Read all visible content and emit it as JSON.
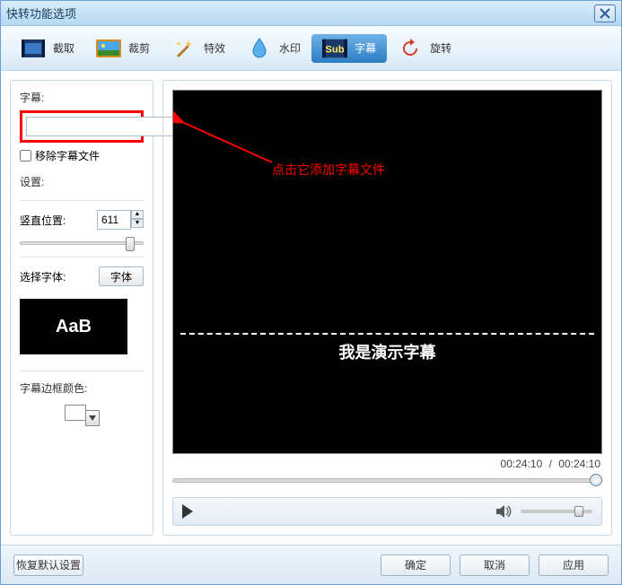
{
  "window": {
    "title": "快转功能选项"
  },
  "toolbar": {
    "items": [
      {
        "label": "截取"
      },
      {
        "label": "裁剪"
      },
      {
        "label": "特效"
      },
      {
        "label": "水印"
      },
      {
        "label": "字幕"
      },
      {
        "label": "旋转"
      }
    ]
  },
  "left": {
    "subtitle_label": "字幕:",
    "subtitle_path": "",
    "remove_label": "移除字幕文件",
    "settings_label": "设置:",
    "vpos_label": "竖直位置:",
    "vpos_value": "611",
    "choose_font_label": "选择字体:",
    "font_btn": "字体",
    "font_preview": "AaB",
    "border_color_label": "字幕边框颜色:"
  },
  "preview": {
    "annotation": "点击它添加字幕文件",
    "demo_subtitle": "我是演示字幕",
    "time_current": "00:24:10",
    "time_total": "00:24:10",
    "time_sep": "/"
  },
  "footer": {
    "restore": "恢复默认设置",
    "ok": "确定",
    "cancel": "取消",
    "apply": "应用"
  }
}
